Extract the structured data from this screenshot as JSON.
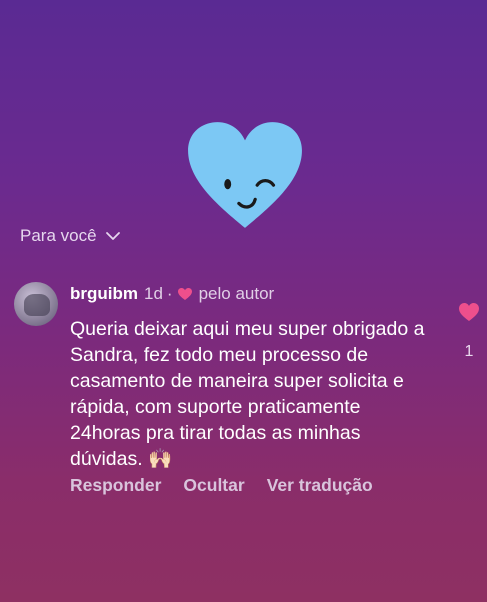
{
  "filter": {
    "label": "Para você"
  },
  "comment": {
    "username": "brguibm",
    "time": "1d",
    "separator": "·",
    "liked_by_author": "pelo autor",
    "text": "Queria deixar aqui meu super obrigado a Sandra, fez todo meu processo de casamento de maneira super solicita e rápida, com suporte praticamente 24horas pra tirar todas as minhas dúvidas. 🙌🏻",
    "like_count": "1",
    "actions": {
      "reply": "Responder",
      "hide": "Ocultar",
      "translate": "Ver tradução"
    }
  },
  "colors": {
    "heart_blue": "#7cc8f4",
    "like_pink": "#ee4f8c"
  },
  "icons": [
    "winking-heart-emoji-icon",
    "chevron-down-icon",
    "small-heart-icon",
    "like-heart-icon"
  ]
}
